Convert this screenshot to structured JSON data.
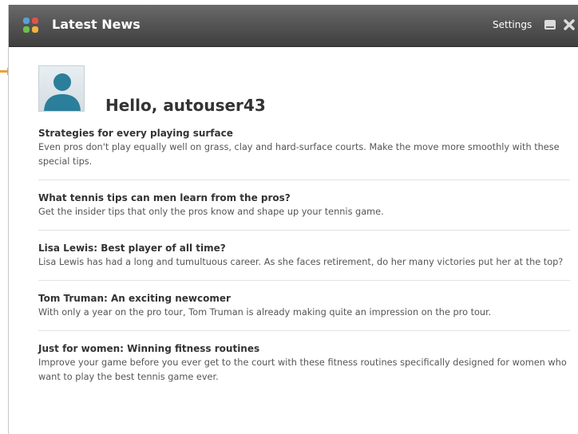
{
  "header": {
    "title": "Latest News",
    "settings_label": "Settings",
    "icon": "app-grid-icon",
    "buttons": [
      "minimize-icon",
      "close-icon"
    ]
  },
  "user": {
    "greeting": "Hello, autouser43",
    "avatar_icon": "user-avatar-icon"
  },
  "news": [
    {
      "title": "Strategies for every playing surface",
      "description": "Even pros don't play equally well on grass, clay and hard-surface courts. Make the move more smoothly with these special tips."
    },
    {
      "title": "What tennis tips can men learn from the pros?",
      "description": "Get the insider tips that only the pros know and shape up your tennis game."
    },
    {
      "title": "Lisa Lewis: Best player of all time?",
      "description": "Lisa Lewis has had a long and tumultuous career. As she faces retirement, do her many victories put her at the top?"
    },
    {
      "title": "Tom Truman: An exciting newcomer",
      "description": "With only a year on the pro tour, Tom Truman is already making quite an impression on the pro tour."
    },
    {
      "title": "Just for women: Winning fitness routines",
      "description": "Improve your game before you ever get to the court with these fitness routines specifically designed for women who want to play the best tennis game ever."
    }
  ],
  "colors": {
    "header_bg": "#4f4f4f",
    "avatar_figure": "#2b7f9a",
    "orange_marker": "#f0a030"
  }
}
